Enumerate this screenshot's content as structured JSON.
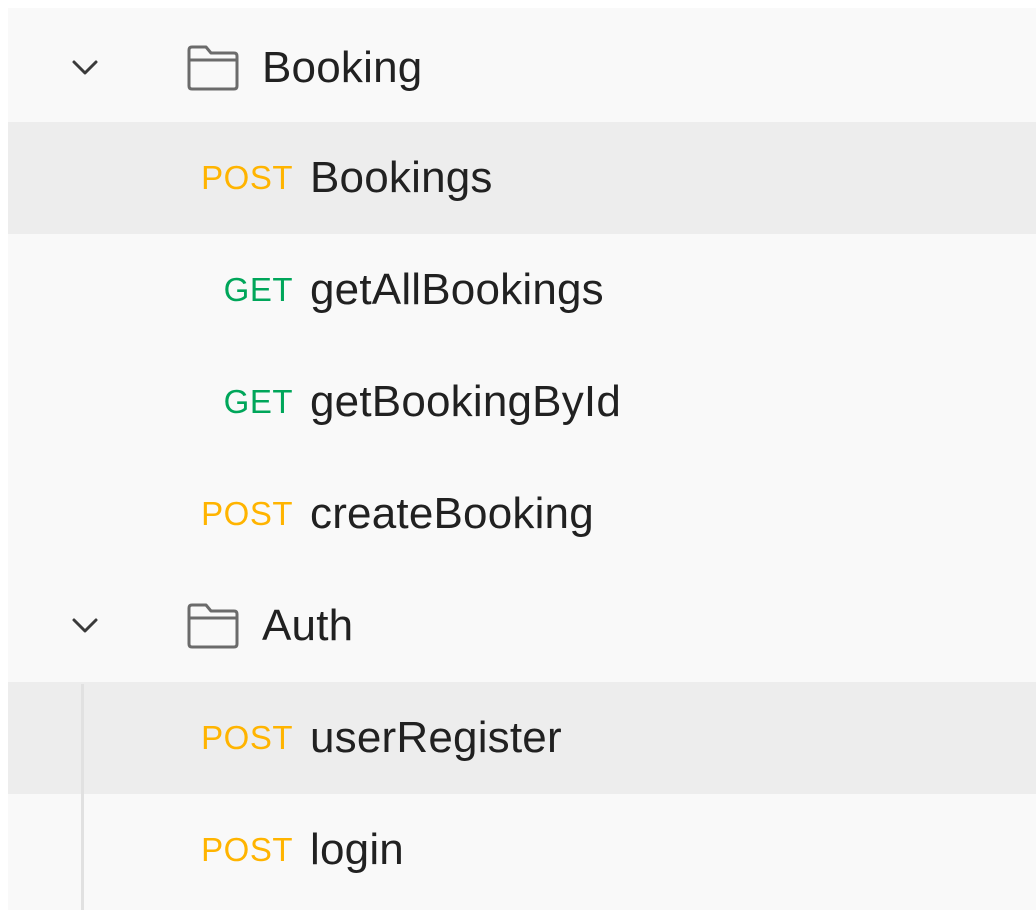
{
  "colors": {
    "post": "#ffb400",
    "get": "#00a65a",
    "text": "#212121",
    "selected_bg": "#ededed",
    "panel_bg": "#f9f9f9"
  },
  "folders": [
    {
      "name": "Booking",
      "expanded": true,
      "chevron_icon": "chevron-down-icon",
      "folder_icon": "folder-icon",
      "requests": [
        {
          "method": "POST",
          "name": "Bookings",
          "selected": true
        },
        {
          "method": "GET",
          "name": "getAllBookings",
          "selected": false
        },
        {
          "method": "GET",
          "name": "getBookingById",
          "selected": false
        },
        {
          "method": "POST",
          "name": "createBooking",
          "selected": false
        }
      ]
    },
    {
      "name": "Auth",
      "expanded": true,
      "chevron_icon": "chevron-down-icon",
      "folder_icon": "folder-icon",
      "requests": [
        {
          "method": "POST",
          "name": "userRegister",
          "selected": true
        },
        {
          "method": "POST",
          "name": "login",
          "selected": false
        }
      ]
    }
  ]
}
